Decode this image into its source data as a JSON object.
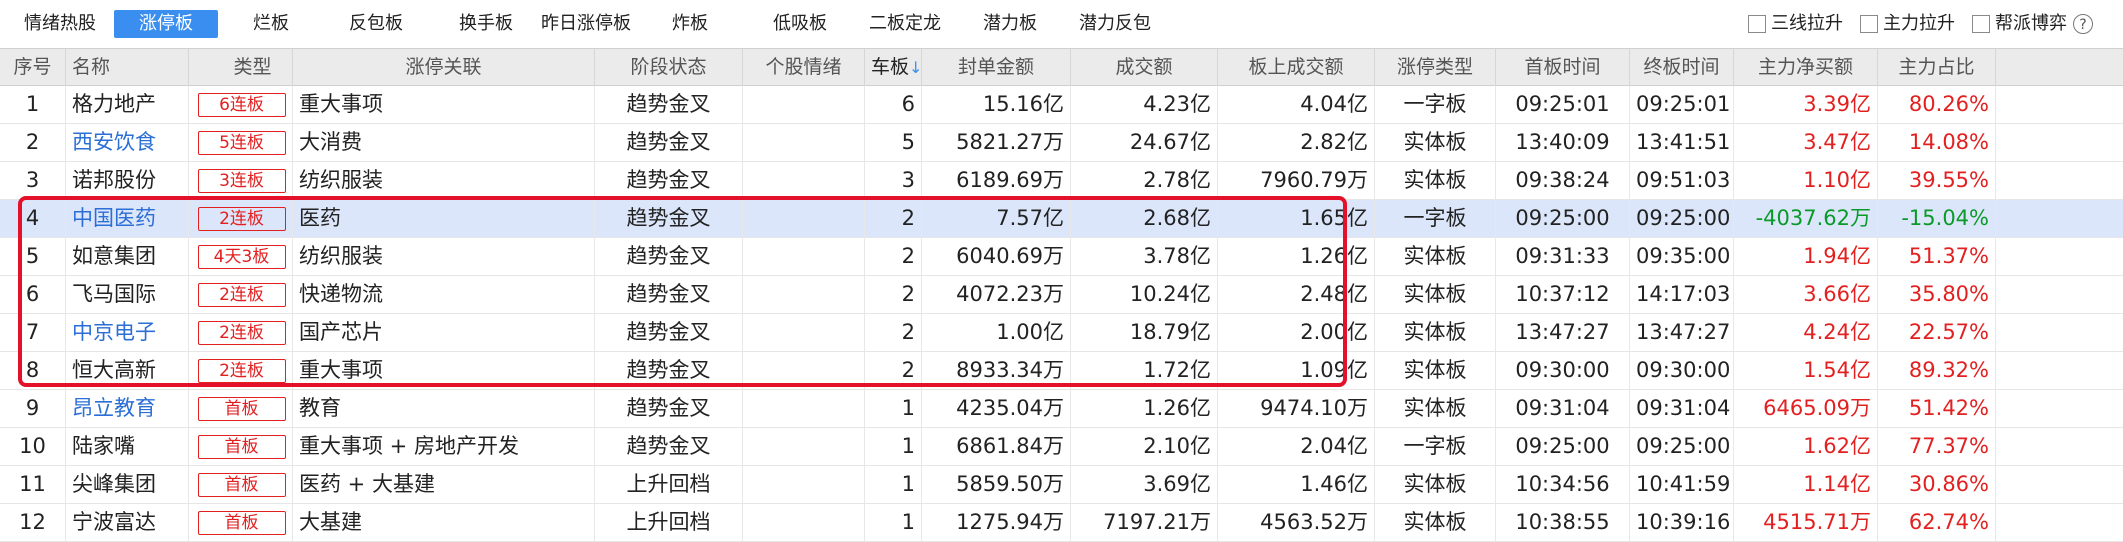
{
  "tabs": [
    {
      "label": "情绪热股",
      "active": false
    },
    {
      "label": "涨停板",
      "active": true
    },
    {
      "label": "烂板",
      "active": false
    },
    {
      "label": "反包板",
      "active": false
    },
    {
      "label": "换手板",
      "active": false
    },
    {
      "label": "昨日涨停板",
      "active": false
    },
    {
      "label": "炸板",
      "active": false
    },
    {
      "label": "低吸板",
      "active": false
    },
    {
      "label": "二板定龙",
      "active": false
    },
    {
      "label": "潜力板",
      "active": false
    },
    {
      "label": "潜力反包",
      "active": false
    }
  ],
  "options": [
    {
      "label": "三线拉升",
      "checked": false
    },
    {
      "label": "主力拉升",
      "checked": false
    },
    {
      "label": "帮派博弈",
      "checked": false
    }
  ],
  "help_glyph": "?",
  "columns": [
    "序号",
    "名称",
    "类型",
    "涨停关联",
    "阶段状态",
    "个股情绪",
    "车板",
    "封单金额",
    "成交额",
    "板上成交额",
    "涨停类型",
    "首板时间",
    "终板时间",
    "主力净买额",
    "主力占比"
  ],
  "sort_indicator": "↓",
  "rows": [
    {
      "no": "1",
      "name": "格力地产",
      "name_blue": false,
      "type": "6连板",
      "theme": "重大事项",
      "stage": "趋势金叉",
      "mood": "",
      "boards": "6",
      "seal": "15.16亿",
      "turnover": "4.23亿",
      "board_turnover": "4.04亿",
      "limit_type": "一字板",
      "first": "09:25:01",
      "last": "09:25:01",
      "net_buy": "3.39亿",
      "net_color": "red",
      "ratio": "80.26%",
      "ratio_color": "red"
    },
    {
      "no": "2",
      "name": "西安饮食",
      "name_blue": true,
      "type": "5连板",
      "theme": "大消费",
      "stage": "趋势金叉",
      "mood": "",
      "boards": "5",
      "seal": "5821.27万",
      "turnover": "24.67亿",
      "board_turnover": "2.82亿",
      "limit_type": "实体板",
      "first": "13:40:09",
      "last": "13:41:51",
      "net_buy": "3.47亿",
      "net_color": "red",
      "ratio": "14.08%",
      "ratio_color": "red"
    },
    {
      "no": "3",
      "name": "诺邦股份",
      "name_blue": false,
      "type": "3连板",
      "theme": "纺织服装",
      "stage": "趋势金叉",
      "mood": "",
      "boards": "3",
      "seal": "6189.69万",
      "turnover": "2.78亿",
      "board_turnover": "7960.79万",
      "limit_type": "实体板",
      "first": "09:38:24",
      "last": "09:51:03",
      "net_buy": "1.10亿",
      "net_color": "red",
      "ratio": "39.55%",
      "ratio_color": "red"
    },
    {
      "no": "4",
      "name": "中国医药",
      "name_blue": true,
      "type": "2连板",
      "theme": "医药",
      "stage": "趋势金叉",
      "mood": "",
      "boards": "2",
      "seal": "7.57亿",
      "turnover": "2.68亿",
      "board_turnover": "1.65亿",
      "limit_type": "一字板",
      "first": "09:25:00",
      "last": "09:25:00",
      "net_buy": "-4037.62万",
      "net_color": "green",
      "ratio": "-15.04%",
      "ratio_color": "green",
      "selected": true
    },
    {
      "no": "5",
      "name": "如意集团",
      "name_blue": false,
      "type": "4天3板",
      "theme": "纺织服装",
      "stage": "趋势金叉",
      "mood": "",
      "boards": "2",
      "seal": "6040.69万",
      "turnover": "3.78亿",
      "board_turnover": "1.26亿",
      "limit_type": "实体板",
      "first": "09:31:33",
      "last": "09:35:00",
      "net_buy": "1.94亿",
      "net_color": "red",
      "ratio": "51.37%",
      "ratio_color": "red"
    },
    {
      "no": "6",
      "name": "飞马国际",
      "name_blue": false,
      "type": "2连板",
      "theme": "快递物流",
      "stage": "趋势金叉",
      "mood": "",
      "boards": "2",
      "seal": "4072.23万",
      "turnover": "10.24亿",
      "board_turnover": "2.48亿",
      "limit_type": "实体板",
      "first": "10:37:12",
      "last": "14:17:03",
      "net_buy": "3.66亿",
      "net_color": "red",
      "ratio": "35.80%",
      "ratio_color": "red"
    },
    {
      "no": "7",
      "name": "中京电子",
      "name_blue": true,
      "type": "2连板",
      "theme": "国产芯片",
      "stage": "趋势金叉",
      "mood": "",
      "boards": "2",
      "seal": "1.00亿",
      "turnover": "18.79亿",
      "board_turnover": "2.00亿",
      "limit_type": "实体板",
      "first": "13:47:27",
      "last": "13:47:27",
      "net_buy": "4.24亿",
      "net_color": "red",
      "ratio": "22.57%",
      "ratio_color": "red"
    },
    {
      "no": "8",
      "name": "恒大高新",
      "name_blue": false,
      "type": "2连板",
      "theme": "重大事项",
      "stage": "趋势金叉",
      "mood": "",
      "boards": "2",
      "seal": "8933.34万",
      "turnover": "1.72亿",
      "board_turnover": "1.09亿",
      "limit_type": "实体板",
      "first": "09:30:00",
      "last": "09:30:00",
      "net_buy": "1.54亿",
      "net_color": "red",
      "ratio": "89.32%",
      "ratio_color": "red"
    },
    {
      "no": "9",
      "name": "昂立教育",
      "name_blue": true,
      "type": "首板",
      "theme": "教育",
      "stage": "趋势金叉",
      "mood": "",
      "boards": "1",
      "seal": "4235.04万",
      "turnover": "1.26亿",
      "board_turnover": "9474.10万",
      "limit_type": "实体板",
      "first": "09:31:04",
      "last": "09:31:04",
      "net_buy": "6465.09万",
      "net_color": "red",
      "ratio": "51.42%",
      "ratio_color": "red"
    },
    {
      "no": "10",
      "name": "陆家嘴",
      "name_blue": false,
      "type": "首板",
      "theme": "重大事项 + 房地产开发",
      "stage": "趋势金叉",
      "mood": "",
      "boards": "1",
      "seal": "6861.84万",
      "turnover": "2.10亿",
      "board_turnover": "2.04亿",
      "limit_type": "一字板",
      "first": "09:25:00",
      "last": "09:25:00",
      "net_buy": "1.62亿",
      "net_color": "red",
      "ratio": "77.37%",
      "ratio_color": "red"
    },
    {
      "no": "11",
      "name": "尖峰集团",
      "name_blue": false,
      "type": "首板",
      "theme": "医药 + 大基建",
      "stage": "上升回档",
      "mood": "",
      "boards": "1",
      "seal": "5859.50万",
      "turnover": "3.69亿",
      "board_turnover": "1.46亿",
      "limit_type": "实体板",
      "first": "10:34:56",
      "last": "10:41:59",
      "net_buy": "1.14亿",
      "net_color": "red",
      "ratio": "30.86%",
      "ratio_color": "red"
    },
    {
      "no": "12",
      "name": "宁波富达",
      "name_blue": false,
      "type": "首板",
      "theme": "大基建",
      "stage": "上升回档",
      "mood": "",
      "boards": "1",
      "seal": "1275.94万",
      "turnover": "7197.21万",
      "board_turnover": "4563.52万",
      "limit_type": "实体板",
      "first": "10:38:55",
      "last": "10:39:16",
      "net_buy": "4515.71万",
      "net_color": "red",
      "ratio": "62.74%",
      "ratio_color": "red"
    }
  ],
  "colors": {
    "accent": "#3a8ef0",
    "up": "#e32020",
    "down": "#0a9a28",
    "link": "#2b6fd6",
    "selected_row": "#dce6fb",
    "highlight_box": "#e3122a"
  }
}
